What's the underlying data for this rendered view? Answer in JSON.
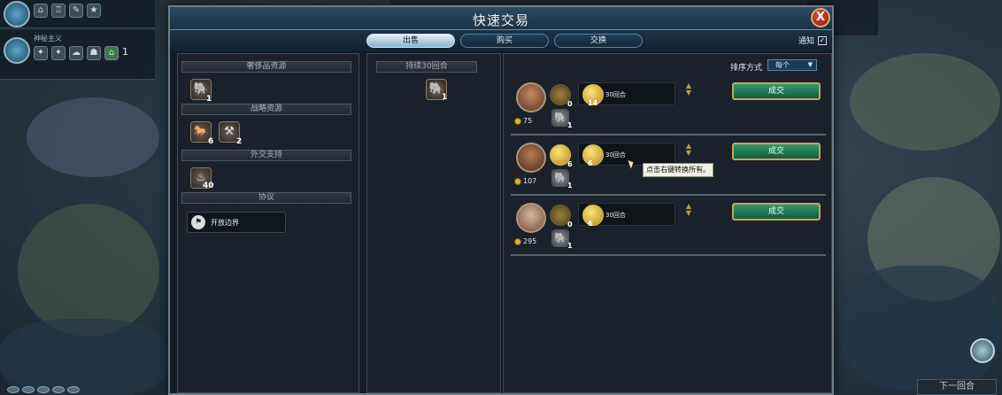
{
  "window": {
    "title": "快速交易",
    "close_label": "X"
  },
  "tabs": [
    {
      "label": "出售",
      "active": true
    },
    {
      "label": "购买",
      "active": false
    },
    {
      "label": "交换",
      "active": false
    }
  ],
  "notify": {
    "label": "通知",
    "checked": "✓"
  },
  "hud": {
    "belief": "神秘主义",
    "count_a": "1",
    "next_turn": "下一回合"
  },
  "left": {
    "luxury_header": "奢侈品资源",
    "luxury": [
      {
        "icon": "elephant-icon",
        "count": "1"
      }
    ],
    "strategic_header": "战略资源",
    "strategic": [
      {
        "icon": "horse-icon",
        "count": "6"
      },
      {
        "icon": "iron-icon",
        "count": "2"
      }
    ],
    "diplomatic_header": "外交支持",
    "diplomatic": [
      {
        "icon": "favor-icon",
        "count": "40"
      }
    ],
    "agreements_header": "协议",
    "agreement": {
      "icon": "open-borders-icon",
      "label": "开放边界"
    }
  },
  "middle": {
    "header": "持续30回合",
    "item": {
      "icon": "elephant-icon",
      "count": "1"
    }
  },
  "right": {
    "sort_label": "排序方式",
    "sort_value": "每个",
    "offers": [
      {
        "gold": "75",
        "slot_count": "0",
        "turns_count": "14",
        "turns_label": "30回合",
        "elephant_count": "1",
        "deal_label": "成交"
      },
      {
        "gold": "107",
        "slot_count": "6",
        "turns_count": "6",
        "turns_label": "30回合",
        "elephant_count": "1",
        "deal_label": "成交"
      },
      {
        "gold": "295",
        "slot_count": "0",
        "turns_count": "6",
        "turns_label": "30回合",
        "elephant_count": "1",
        "deal_label": "成交"
      }
    ],
    "tooltip": "点击右键转换所有。"
  },
  "colors": {
    "accent_green": "#2f9a6b",
    "gold": "#d8b13c",
    "title_blue": "#2b4a63"
  }
}
